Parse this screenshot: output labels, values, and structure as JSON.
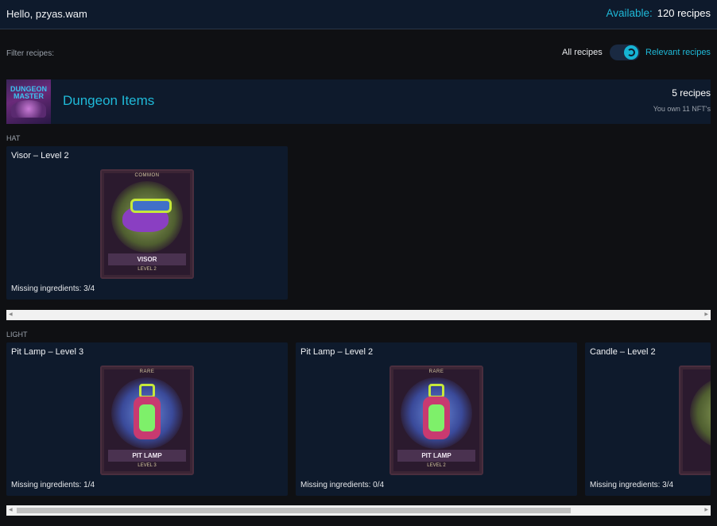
{
  "header": {
    "greeting": "Hello, pzyas.wam",
    "available_label": "Available:",
    "available_count": "120 recipes"
  },
  "filter": {
    "label": "Filter recipes:",
    "option_all": "All recipes",
    "option_relevant": "Relevant recipes",
    "selected": "Relevant recipes"
  },
  "collection": {
    "thumb_text": "DUNGEON MASTER",
    "title": "Dungeon Items",
    "recipes_count": "5 recipes",
    "owned": "You own 11 NFT's"
  },
  "categories": [
    {
      "label": "HAT",
      "cards": [
        {
          "title": "Visor – Level 2",
          "rarity": "COMMON",
          "name": "VISOR",
          "level": "LEVEL 2",
          "missing": "Missing ingredients: 3/4",
          "art": "visor"
        }
      ]
    },
    {
      "label": "LIGHT",
      "cards": [
        {
          "title": "Pit Lamp – Level 3",
          "rarity": "RARE",
          "name": "PIT LAMP",
          "level": "LEVEL 3",
          "missing": "Missing ingredients: 1/4",
          "art": "lamp"
        },
        {
          "title": "Pit Lamp – Level 2",
          "rarity": "RARE",
          "name": "PIT LAMP",
          "level": "LEVEL 2",
          "missing": "Missing ingredients: 0/4",
          "art": "lamp"
        },
        {
          "title": "Candle – Level 2",
          "rarity": "",
          "name": "",
          "level": "",
          "missing": "Missing ingredients: 3/4",
          "art": "candle"
        }
      ]
    }
  ],
  "scroll": {
    "hat_fraction": 1.0,
    "light_fraction": 0.81
  },
  "colors": {
    "accent": "#1fb9d8",
    "panel": "#0e1a2c",
    "background": "#0f1013"
  },
  "icons": {
    "toggle_knob": "swirl-icon",
    "scroll_left": "arrow-left-icon",
    "scroll_right": "arrow-right-icon"
  }
}
